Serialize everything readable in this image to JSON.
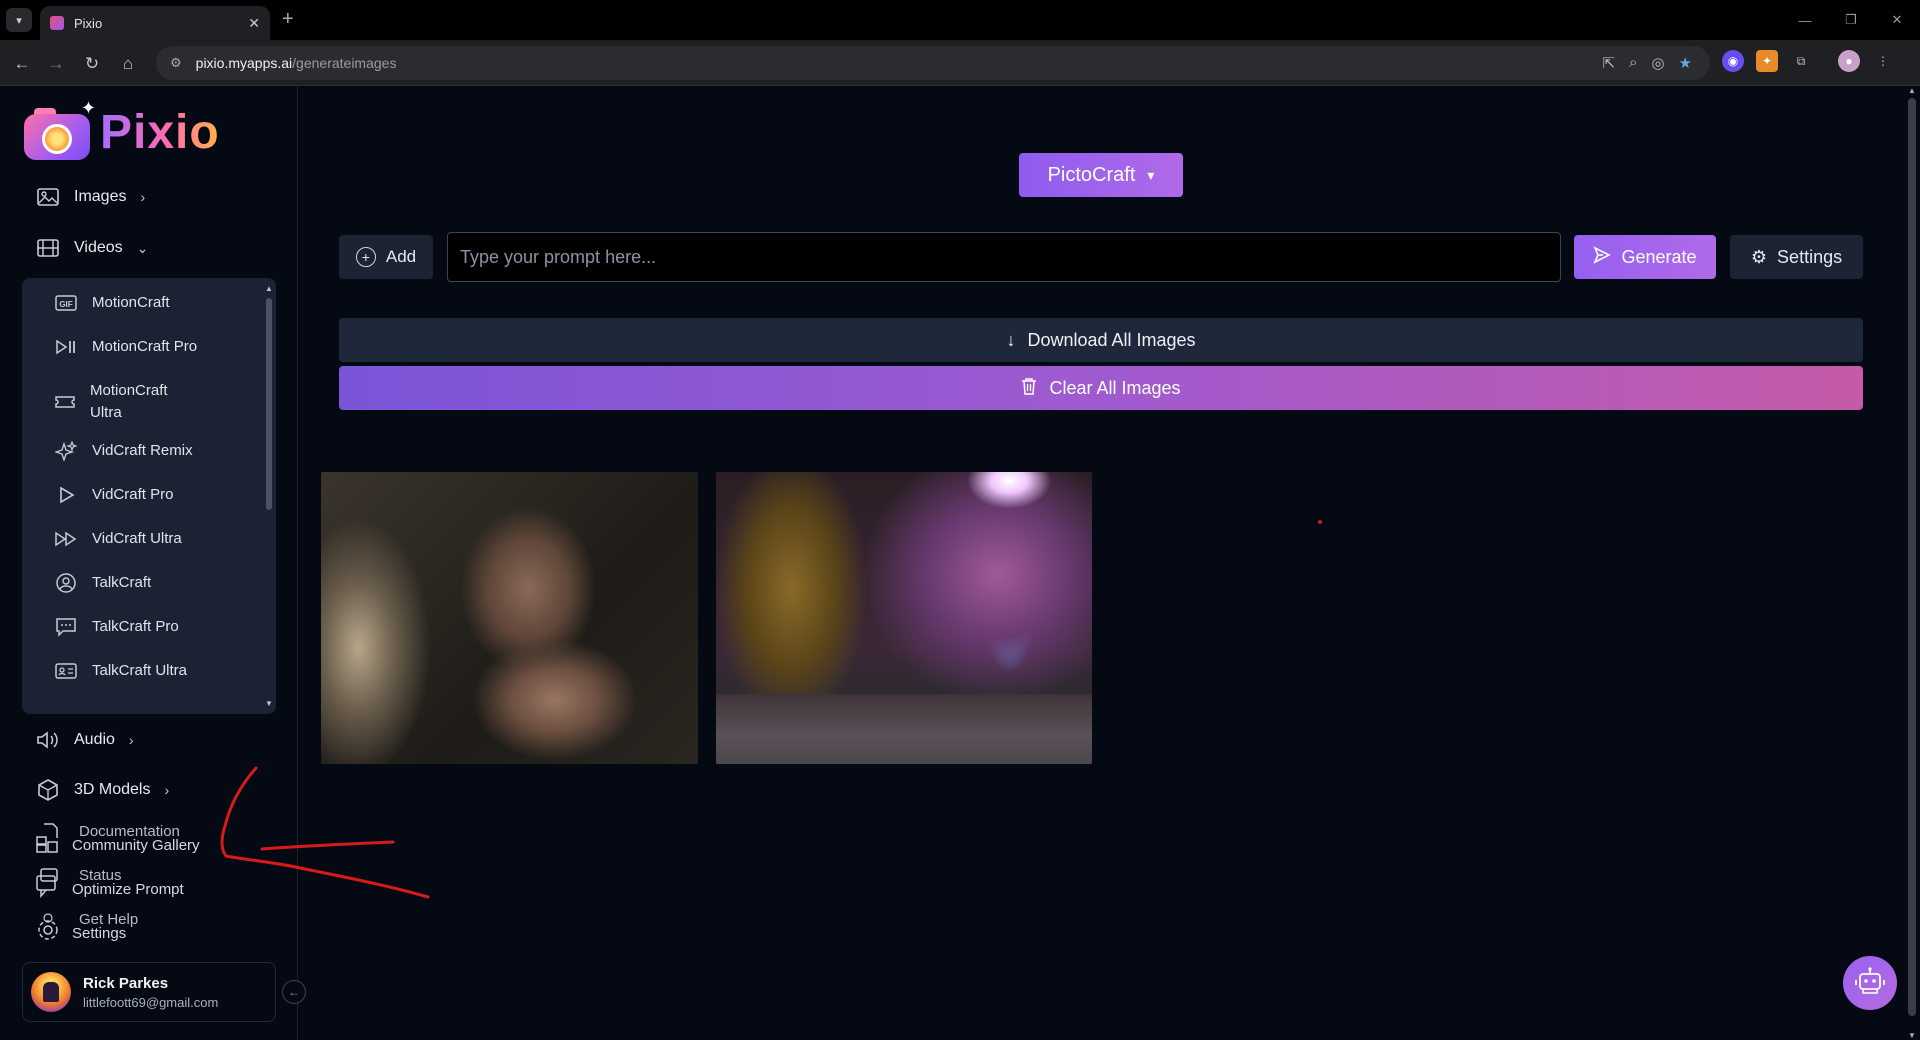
{
  "browser": {
    "tab_title": "Pixio",
    "url_host": "pixio.myapps.ai",
    "url_path": "/generateimages"
  },
  "app": {
    "logo_text": "Pixio",
    "nav": {
      "images": "Images",
      "videos": "Videos",
      "audio": "Audio",
      "models_3d": "3D Models"
    },
    "video_submenu": [
      {
        "label": "MotionCraft",
        "icon": "gif-icon"
      },
      {
        "label": "MotionCraft Pro",
        "icon": "play-pause-icon"
      },
      {
        "label": "MotionCraft Ultra",
        "icon": "ticket-icon"
      },
      {
        "label": "VidCraft Remix",
        "icon": "sparkles-icon"
      },
      {
        "label": "VidCraft Pro",
        "icon": "play-icon"
      },
      {
        "label": "VidCraft Ultra",
        "icon": "fast-forward-icon"
      },
      {
        "label": "TalkCraft",
        "icon": "user-circle-icon"
      },
      {
        "label": "TalkCraft Pro",
        "icon": "chat-bubble-icon"
      },
      {
        "label": "TalkCraft Ultra",
        "icon": "id-card-icon"
      }
    ],
    "bottom_links": {
      "documentation": "Documentation",
      "community_gallery": "Community Gallery",
      "status": "Status",
      "optimize_prompt": "Optimize Prompt",
      "get_help": "Get Help",
      "settings": "Settings"
    },
    "user": {
      "name": "Rick Parkes",
      "email": "littlefoott69@gmail.com"
    }
  },
  "main": {
    "model_selector": "PictoCraft",
    "add_label": "Add",
    "prompt_placeholder": "Type your prompt here...",
    "prompt_value": "",
    "generate_label": "Generate",
    "settings_label": "Settings",
    "download_all_label": "Download All Images",
    "clear_all_label": "Clear All Images",
    "images": [
      {
        "alt": "woman-hand-over-mouth"
      },
      {
        "alt": "glitter-post-purple-light"
      }
    ]
  },
  "colors": {
    "background": "#050914",
    "accent": "#9560f0",
    "panel": "#1a2233"
  }
}
